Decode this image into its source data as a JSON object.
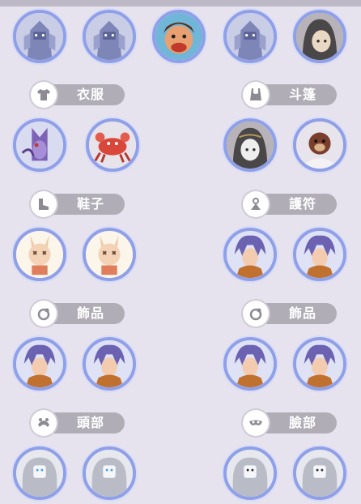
{
  "sections": {
    "clothes": {
      "label": "衣服",
      "icon": "shirt-icon"
    },
    "cloak": {
      "label": "斗篷",
      "icon": "cloak-icon"
    },
    "shoes": {
      "label": "鞋子",
      "icon": "shoe-icon"
    },
    "amulet": {
      "label": "護符",
      "icon": "amulet-icon"
    },
    "accessory_left": {
      "label": "飾品",
      "icon": "ring-icon"
    },
    "accessory_right": {
      "label": "飾品",
      "icon": "ring-icon"
    },
    "head": {
      "label": "頭部",
      "icon": "headband-icon"
    },
    "face": {
      "label": "臉部",
      "icon": "mask-icon"
    }
  },
  "colors": {
    "background": "#e7e3ee",
    "avatar_ring": "#8fa0e8",
    "pill": "#b0adb7"
  }
}
